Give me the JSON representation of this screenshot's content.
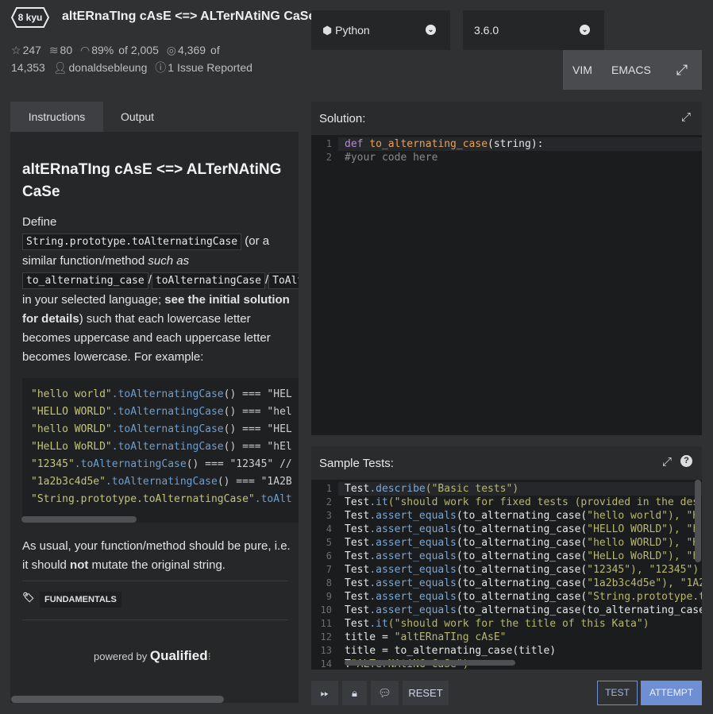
{
  "header": {
    "kyu": "8 kyu",
    "title": "altERnaTIng cAsE <=> ALTerNAtiNG CaSe",
    "stars": "247",
    "collections": "80",
    "satisfaction": "89%",
    "satisfaction_of": "of 2,005",
    "completions": "4,369",
    "completions_of": "of",
    "total": "14,353",
    "author": "donaldsebleung",
    "issues": "1 Issue Reported"
  },
  "language": {
    "selected": "Python"
  },
  "version": {
    "selected": "3.6.0"
  },
  "modes": {
    "vim": "VIM",
    "emacs": "EMACS"
  },
  "tabs": {
    "instructions": "Instructions",
    "output": "Output"
  },
  "instructions": {
    "title": "altERnaTIng cAsE <=> ALTerNAtiNG CaSe",
    "p1_define": "Define",
    "p1_code1": "String.prototype.toAlternatingCase",
    "p1_or": "(or a similar function/method",
    "p1_such": "such as",
    "p1_code2": "to_alternating_case",
    "p1_slash": "/",
    "p1_code3": "toAlternatingCase",
    "p1_code4": "ToAlternatingCase",
    "p1_lang": "in your selected language;",
    "p1_bold": "see the initial solution for details",
    "p1_rest": ") such that each lowercase letter becomes uppercase and each uppercase letter becomes lowercase. For example:",
    "examples": [
      {
        "s": "\"hello world\"",
        "m": ".toAlternatingCase",
        "r": "() === \"HEL"
      },
      {
        "s": "\"HELLO WORLD\"",
        "m": ".toAlternatingCase",
        "r": "() === \"hel"
      },
      {
        "s": "\"hello WORLD\"",
        "m": ".toAlternatingCase",
        "r": "() === \"HEL"
      },
      {
        "s": "\"HeLLo WoRLD\"",
        "m": ".toAlternatingCase",
        "r": "() === \"hEl"
      },
      {
        "s": "\"12345\"",
        "m": ".toAlternatingCase",
        "r": "() === \"12345\" //"
      },
      {
        "s": "\"1a2b3c4d5e\"",
        "m": ".toAlternatingCase",
        "r": "() === \"1A2B"
      },
      {
        "s": "\"String.prototype.toAlternatingCase\"",
        "m": ".toAlt",
        "r": ""
      }
    ],
    "p2_a": "As usual, your function/method should be pure, i.e. it should",
    "p2_not": "not",
    "p2_b": "mutate the original string.",
    "tag": "FUNDAMENTALS",
    "powered_by": "powered by",
    "qualified": "Qualified"
  },
  "solution": {
    "label": "Solution:",
    "lines": [
      {
        "n": "1",
        "kw": "def",
        "name": "to_alternating_case",
        "rest": "(string):"
      },
      {
        "n": "2",
        "cmt": "    #your code here"
      }
    ]
  },
  "tests": {
    "label": "Sample Tests:",
    "lines": [
      {
        "n": "1",
        "a": "Test",
        "f": ".describe",
        "s": "(\"Basic tests\")",
        "t": ""
      },
      {
        "n": "2",
        "a": "Test",
        "f": ".it",
        "s": "(\"should work for fixed tests (provided in the des",
        "t": ""
      },
      {
        "n": "3",
        "a": "Test",
        "f": ".assert_equals",
        "s": "(to_alternating_case(",
        "t": "\"hello world\"), \"H"
      },
      {
        "n": "4",
        "a": "Test",
        "f": ".assert_equals",
        "s": "(to_alternating_case(",
        "t": "\"HELLO WORLD\"), \"h"
      },
      {
        "n": "5",
        "a": "Test",
        "f": ".assert_equals",
        "s": "(to_alternating_case(",
        "t": "\"hello WORLD\"), \"H"
      },
      {
        "n": "6",
        "a": "Test",
        "f": ".assert_equals",
        "s": "(to_alternating_case(",
        "t": "\"HeLLo WoRLD\"), \"h"
      },
      {
        "n": "7",
        "a": "Test",
        "f": ".assert_equals",
        "s": "(to_alternating_case(",
        "t": "\"12345\"), \"12345\")"
      },
      {
        "n": "8",
        "a": "Test",
        "f": ".assert_equals",
        "s": "(to_alternating_case(",
        "t": "\"1a2b3c4d5e\"), \"1A2B"
      },
      {
        "n": "9",
        "a": "Test",
        "f": ".assert_equals",
        "s": "(to_alternating_case(",
        "t": "\"String.prototype.to"
      },
      {
        "n": "10",
        "a": "Test",
        "f": ".assert_equals",
        "s": "(to_alternating_case(to_alternating_case",
        "t": ""
      },
      {
        "n": "11",
        "a": "Test",
        "f": ".it",
        "s": "(\"should work for the title of this Kata\")",
        "t": ""
      },
      {
        "n": "12",
        "a": "title = ",
        "f": "",
        "s": "",
        "t": "\"altERnaTIng cAsE\""
      },
      {
        "n": "13",
        "a": "title = to_alternating_case(title)",
        "f": "",
        "s": "",
        "t": ""
      },
      {
        "n": "14",
        "a": "T",
        "f": "",
        "s": "",
        "t": "\"ALTerNAtiNG CaSe\")"
      }
    ]
  },
  "toolbar": {
    "reset": "RESET",
    "test": "TEST",
    "attempt": "ATTEMPT"
  }
}
